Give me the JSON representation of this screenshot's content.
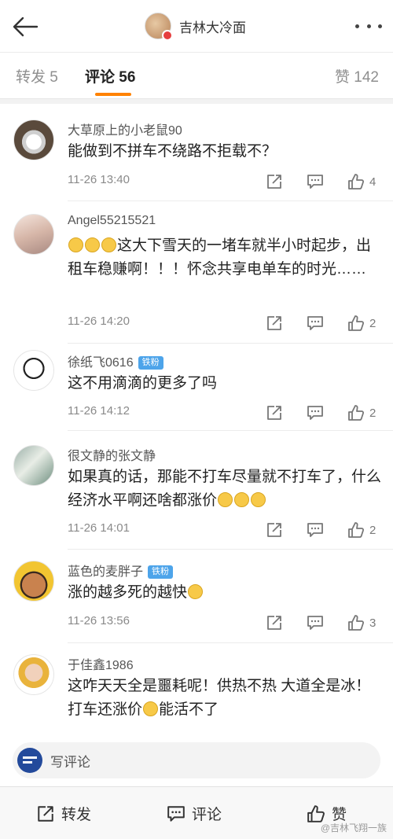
{
  "header": {
    "title": "吉林大冷面"
  },
  "tabs": {
    "repost": "转发 5",
    "comment": "评论 56",
    "like": "赞 142"
  },
  "comments": [
    {
      "username": "大草原上的小老鼠90",
      "badge": "",
      "text": "能做到不拼车不绕路不拒载不？",
      "time": "11-26 13:40",
      "likes": "4"
    },
    {
      "username": "Angel55215521",
      "badge": "",
      "text": "这大下雪天的一堵车就半小时起步，出租车稳赚啊！！！怀念共享电单车的时光……",
      "time": "11-26 14:20",
      "likes": "2"
    },
    {
      "username": "徐纸飞0616",
      "badge": "铁粉",
      "text": "这不用滴滴的更多了吗",
      "time": "11-26 14:12",
      "likes": "2"
    },
    {
      "username": "很文静的张文静",
      "badge": "",
      "text": "如果真的话，那能不打车尽量就不打车了，什么经济水平啊还啥都涨价",
      "time": "11-26 14:01",
      "likes": "2"
    },
    {
      "username": "蓝色的麦胖子",
      "badge": "铁粉",
      "text": "涨的越多死的越快",
      "time": "11-26 13:56",
      "likes": "3"
    },
    {
      "username": "于佳鑫1986",
      "badge": "",
      "text": "这咋天天全是噩耗呢！供热不热 大道全是冰！打车还涨价",
      "text_tail": "能活不了",
      "time": "",
      "likes": ""
    }
  ],
  "write_comment": {
    "placeholder": "写评论"
  },
  "bottom_bar": {
    "repost": "转发",
    "comment": "评论",
    "like": "赞"
  },
  "watermark": "@吉林飞翔一族",
  "colors": {
    "accent": "#ff8200",
    "fan_badge": "#4da4ea"
  }
}
